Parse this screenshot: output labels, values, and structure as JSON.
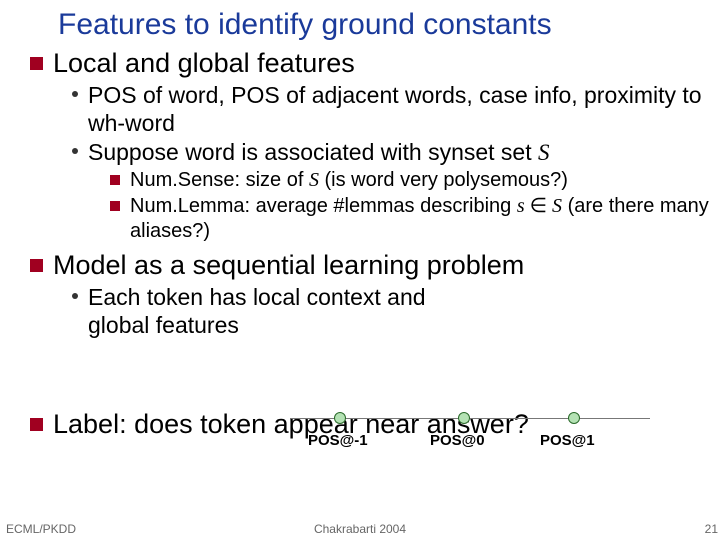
{
  "title": "Features to identify ground constants",
  "sections": {
    "local_global": "Local and global features",
    "pos_line": "POS of word, POS of adjacent words, case info, proximity to wh-word",
    "suppose_a": "Suppose word is associated with synset set ",
    "suppose_S": "S",
    "numsense_a": "Num.Sense: size of ",
    "numsense_S": "S",
    "numsense_b": "  (is word very polysemous?)",
    "numlemma_a": "Num.Lemma: average #lemmas describing ",
    "numlemma_s": "s",
    "numlemma_el": " ∈ ",
    "numlemma_S": "S",
    "numlemma_b": " (are there many aliases?)",
    "model": "Model as a sequential learning problem",
    "each_token": "Each token has local context and global features",
    "label": "Label: does token appear near answer?"
  },
  "diagram": {
    "p_minus1": "POS@-1",
    "p_0": "POS@0",
    "p_1": "POS@1"
  },
  "footer": {
    "left": "ECML/PKDD",
    "center": "Chakrabarti 2004",
    "right": "21"
  }
}
